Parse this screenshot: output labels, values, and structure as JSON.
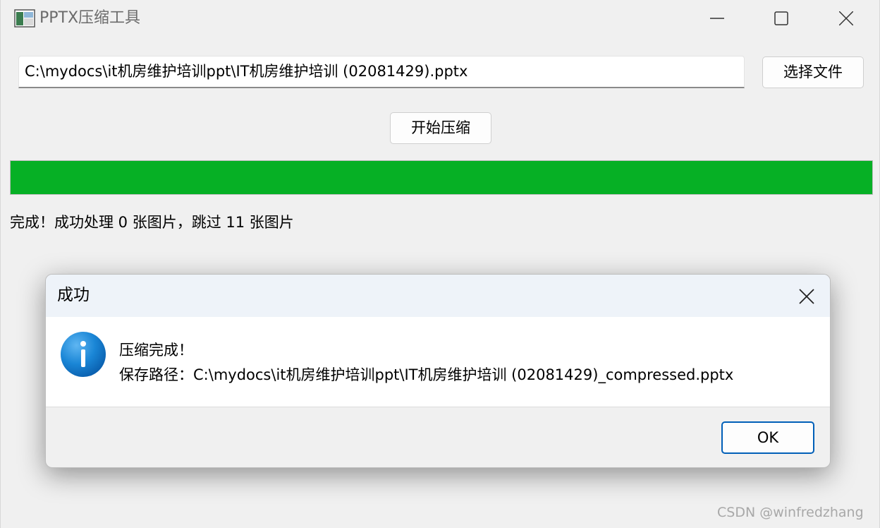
{
  "window": {
    "title": "PPTX压缩工具"
  },
  "file": {
    "path_value": "C:\\mydocs\\it机房维护培训ppt\\IT机房维护培训 (02081429).pptx",
    "choose_label": "选择文件"
  },
  "actions": {
    "start_label": "开始压缩"
  },
  "progress": {
    "percent": 100,
    "color": "#06b025"
  },
  "status": {
    "text": "完成！成功处理 0 张图片，跳过 11 张图片"
  },
  "dialog": {
    "title": "成功",
    "line1": "压缩完成！",
    "line2": "保存路径：C:\\mydocs\\it机房维护培训ppt\\IT机房维护培训 (02081429)_compressed.pptx",
    "ok_label": "OK",
    "icon": "info-icon"
  },
  "watermark": {
    "text": "CSDN @winfredzhang"
  }
}
